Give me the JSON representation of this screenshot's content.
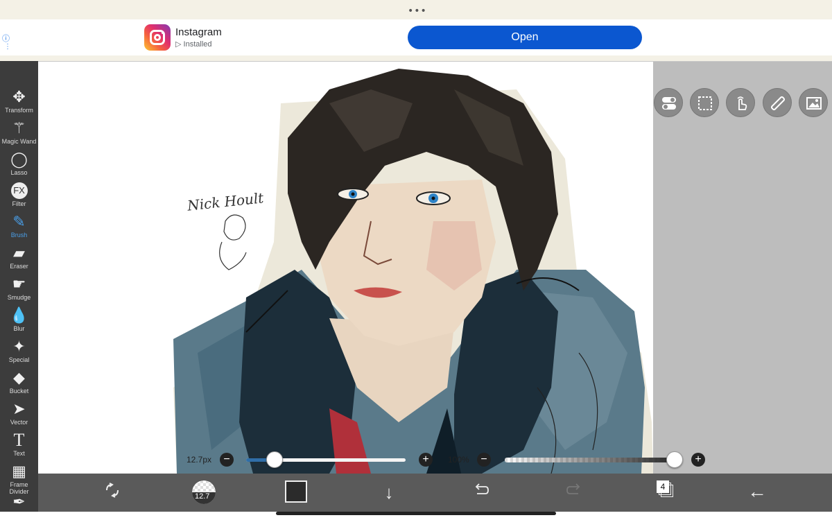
{
  "browser": {
    "dots": "•••"
  },
  "ad": {
    "app_name": "Instagram",
    "status": "Installed",
    "open_label": "Open",
    "brand_colors": [
      "#fdc830",
      "#f56040",
      "#e1306c",
      "#833ab4"
    ],
    "button_color": "#0b57d0"
  },
  "tools": [
    {
      "label": "Transform",
      "icon": "move-arrows-icon"
    },
    {
      "label": "Magic Wand",
      "icon": "magic-wand-icon"
    },
    {
      "label": "Lasso",
      "icon": "lasso-icon"
    },
    {
      "label": "Filter",
      "icon": "fx-icon"
    },
    {
      "label": "Brush",
      "icon": "brush-icon",
      "active": true
    },
    {
      "label": "Eraser",
      "icon": "eraser-icon"
    },
    {
      "label": "Smudge",
      "icon": "smudge-icon"
    },
    {
      "label": "Blur",
      "icon": "blur-drop-icon"
    },
    {
      "label": "Special",
      "icon": "special-wand-icon"
    },
    {
      "label": "Bucket",
      "icon": "bucket-icon"
    },
    {
      "label": "Vector",
      "icon": "vector-pointer-icon"
    },
    {
      "label": "Text",
      "icon": "text-icon"
    },
    {
      "label": "Frame Divider",
      "icon": "frame-divider-icon"
    }
  ],
  "canvas": {
    "handwriting": "Nick Hoult"
  },
  "right_tools": [
    {
      "name": "toggle-icon"
    },
    {
      "name": "selection-icon"
    },
    {
      "name": "touch-icon"
    },
    {
      "name": "ruler-icon"
    },
    {
      "name": "image-icon"
    }
  ],
  "brush": {
    "size_label": "12.7px",
    "size_value": 12.7,
    "size_fraction": 0.18,
    "opacity_label": "100%",
    "opacity_fraction": 1.0,
    "accent_color": "#2f6ea8"
  },
  "bottom": {
    "brush_preview": "12.7",
    "color_hex": "#2b2b2b",
    "layers_count": "4"
  }
}
